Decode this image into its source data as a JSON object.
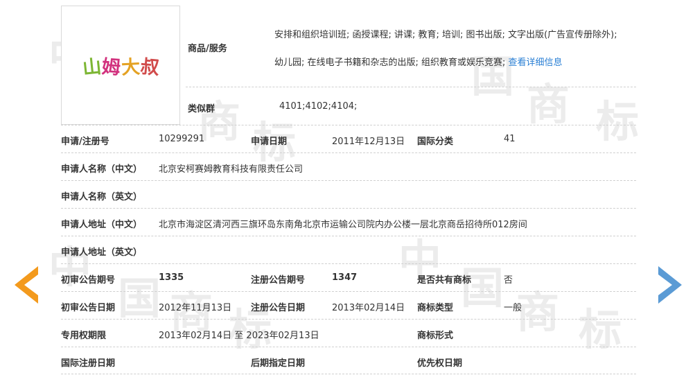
{
  "watermark": {
    "zhong": "中",
    "guo": "国",
    "shang": "商",
    "biao": "标"
  },
  "logo": {
    "text": "山姆大叔",
    "chars": [
      "山",
      "姆",
      "大",
      "叔"
    ],
    "colors": [
      "#7db634",
      "#d2327e",
      "#e4a224",
      "#d14b4b"
    ]
  },
  "goods": {
    "label": "商品/服务",
    "line1": "安排和组织培训班; 函授课程; 讲课; 教育; 培训; 图书出版; 文字出版(广告宣传册除外);",
    "line2": "幼儿园; 在线电子书籍和杂志的出版; 组织教育或娱乐竞赛;",
    "more_link": "查看详细信息"
  },
  "similar_group": {
    "label": "类似群",
    "value": "4101;4102;4104;"
  },
  "reg_no": {
    "label": "申请/注册号",
    "value": "10299291"
  },
  "app_date": {
    "label": "申请日期",
    "value": "2011年12月13日"
  },
  "intl_class": {
    "label": "国际分类",
    "value": "41"
  },
  "applicant_cn": {
    "label": "申请人名称（中文）",
    "value": "北京安柯赛姆教育科技有限责任公司"
  },
  "applicant_en": {
    "label": "申请人名称（英文）",
    "value": ""
  },
  "address_cn": {
    "label": "申请人地址（中文）",
    "value": "北京市海淀区清河西三旗环岛东南角北京市运输公司院内办公楼一层北京商岳招待所012房间"
  },
  "address_en": {
    "label": "申请人地址（英文）",
    "value": ""
  },
  "prelim_issue": {
    "label": "初审公告期号",
    "value": "1335"
  },
  "reg_issue": {
    "label": "注册公告期号",
    "value": "1347"
  },
  "shared_mark": {
    "label": "是否共有商标",
    "value": "否"
  },
  "prelim_date": {
    "label": "初审公告日期",
    "value": "2012年11月13日"
  },
  "reg_date": {
    "label": "注册公告日期",
    "value": "2013年02月14日"
  },
  "mark_type": {
    "label": "商标类型",
    "value": "一般"
  },
  "exclusive_period": {
    "label": "专用权期限",
    "value": "2013年02月14日 至 2023年02月13日"
  },
  "mark_form": {
    "label": "商标形式",
    "value": ""
  },
  "intl_reg_date": {
    "label": "国际注册日期",
    "value": ""
  },
  "later_designation": {
    "label": "后期指定日期",
    "value": ""
  },
  "priority_date": {
    "label": "优先权日期",
    "value": ""
  },
  "colors": {
    "prev_arrow": "#f39a1d",
    "next_arrow": "#5b9bd5",
    "link": "#2a7fd4"
  }
}
